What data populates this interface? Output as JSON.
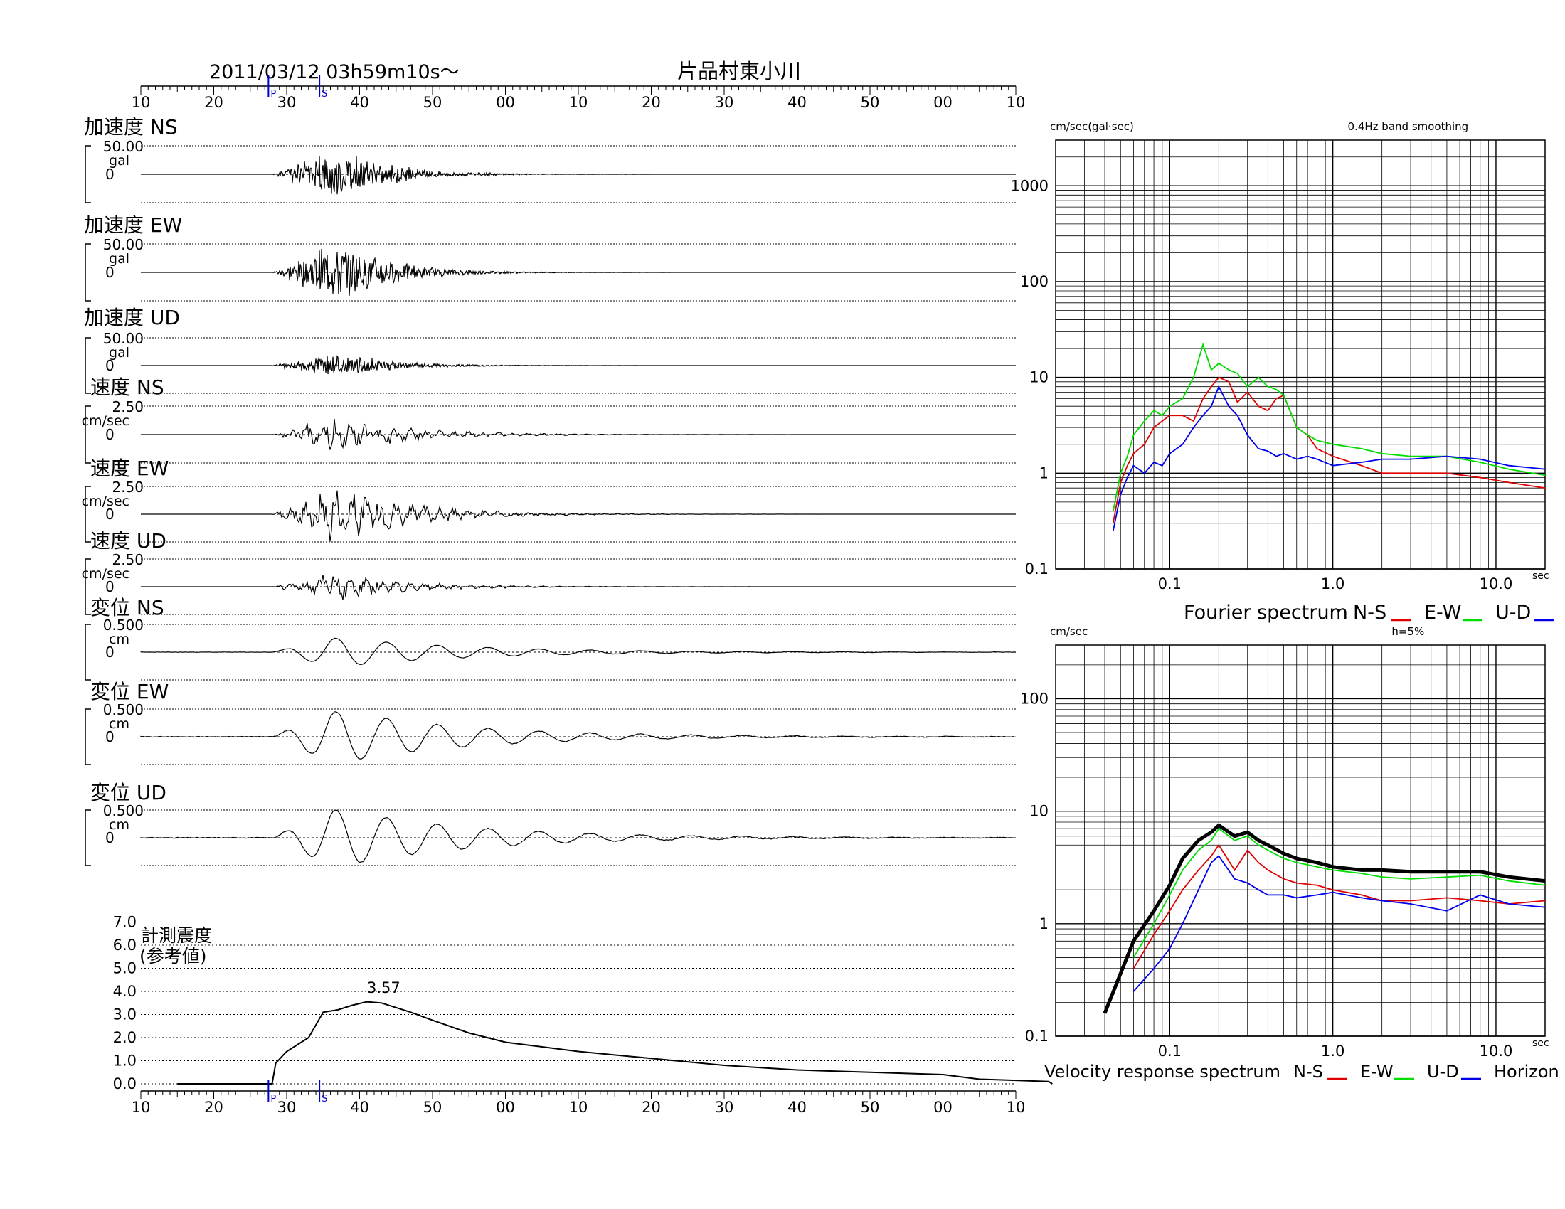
{
  "header": {
    "datetime": "2011/03/12  03h59m10s〜",
    "station": "片品村東小川"
  },
  "time_axis": {
    "tick_labels": [
      "10",
      "20",
      "30",
      "40",
      "50",
      "00",
      "10",
      "20",
      "30",
      "40",
      "50",
      "00",
      "10"
    ],
    "p_marker": "P",
    "s_marker": "S"
  },
  "traces": [
    {
      "title": "加速度 NS",
      "scale": "50.00",
      "unit": "gal",
      "zero": "0",
      "kind": "acc",
      "amp": 0.9,
      "seed": 3
    },
    {
      "title": "加速度 EW",
      "scale": "50.00",
      "unit": "gal",
      "zero": "0",
      "kind": "acc",
      "amp": 1.15,
      "seed": 7
    },
    {
      "title": "加速度 UD",
      "scale": "50.00",
      "unit": "gal",
      "zero": "0",
      "kind": "acc",
      "amp": 0.5,
      "seed": 11
    },
    {
      "title": "速度 NS",
      "scale": "2.50",
      "unit": "cm/sec",
      "zero": "0",
      "kind": "vel",
      "amp": 0.6,
      "seed": 13
    },
    {
      "title": "速度 EW",
      "scale": "2.50",
      "unit": "cm/sec",
      "zero": "0",
      "kind": "vel",
      "amp": 0.95,
      "seed": 17
    },
    {
      "title": "速度 UD",
      "scale": "2.50",
      "unit": "cm/sec",
      "zero": "0",
      "kind": "vel",
      "amp": 0.45,
      "seed": 19
    },
    {
      "title": "変位 NS",
      "scale": "0.500",
      "unit": "cm",
      "zero": "0",
      "kind": "disp",
      "amp": 0.5,
      "seed": 23
    },
    {
      "title": "変位 EW",
      "scale": "0.500",
      "unit": "cm",
      "zero": "0",
      "kind": "disp",
      "amp": 0.9,
      "seed": 29
    },
    {
      "title": "変位 UD",
      "scale": "0.500",
      "unit": "cm",
      "zero": "0",
      "kind": "disp",
      "amp": 1.0,
      "seed": 31
    }
  ],
  "intensity": {
    "title_line1": "計測震度",
    "title_line2": "(参考値)",
    "max_label": "3.57",
    "y_ticks": [
      "7.0",
      "6.0",
      "5.0",
      "4.0",
      "3.0",
      "2.0",
      "1.0",
      "0.0"
    ]
  },
  "colors": {
    "ns": "#e00000",
    "ew": "#00dd00",
    "ud": "#0000ee",
    "horizon": "#000000",
    "marker": "#0000cc"
  },
  "chart_data": [
    {
      "type": "line",
      "title": "Fourier spectrum",
      "ylabel": "cm/sec(gal·sec)",
      "xlabel": "sec",
      "note": "0.4Hz band smoothing",
      "x_scale": "log",
      "y_scale": "log",
      "xlim": [
        0.02,
        20
      ],
      "ylim": [
        0.1,
        3000
      ],
      "x_tick_labels": [
        "0.1",
        "1.0",
        "10.0"
      ],
      "y_tick_labels": [
        "0.1",
        "1",
        "10",
        "100",
        "1000"
      ],
      "legend": [
        "N-S",
        "E-W",
        "U-D"
      ],
      "series": [
        {
          "name": "N-S",
          "color": "#e00000",
          "x": [
            0.045,
            0.05,
            0.055,
            0.06,
            0.07,
            0.08,
            0.09,
            0.1,
            0.12,
            0.14,
            0.16,
            0.18,
            0.2,
            0.23,
            0.26,
            0.3,
            0.35,
            0.4,
            0.45,
            0.5,
            0.6,
            0.7,
            0.8,
            1.0,
            1.5,
            2,
            3,
            5,
            8,
            12,
            20
          ],
          "y": [
            0.3,
            0.8,
            1.2,
            1.6,
            2.0,
            3.0,
            3.5,
            4.0,
            4.0,
            3.5,
            6.0,
            8.0,
            10.0,
            9.0,
            5.5,
            7.0,
            5.0,
            4.5,
            6.0,
            6.5,
            3.0,
            2.5,
            1.8,
            1.5,
            1.2,
            1.0,
            1.0,
            1.0,
            0.9,
            0.8,
            0.7
          ]
        },
        {
          "name": "E-W",
          "color": "#00dd00",
          "x": [
            0.045,
            0.05,
            0.055,
            0.06,
            0.07,
            0.08,
            0.09,
            0.1,
            0.12,
            0.14,
            0.16,
            0.18,
            0.2,
            0.23,
            0.26,
            0.3,
            0.35,
            0.4,
            0.45,
            0.5,
            0.6,
            0.7,
            0.8,
            1.0,
            1.5,
            2,
            3,
            5,
            8,
            12,
            20
          ],
          "y": [
            0.4,
            1.0,
            1.5,
            2.5,
            3.5,
            4.5,
            4.0,
            5.0,
            6.0,
            10.0,
            22.0,
            12.0,
            14.0,
            12.0,
            11.0,
            8.0,
            10.0,
            8.0,
            7.5,
            6.5,
            3.0,
            2.5,
            2.2,
            2.0,
            1.8,
            1.6,
            1.5,
            1.5,
            1.3,
            1.1,
            0.95
          ]
        },
        {
          "name": "U-D",
          "color": "#0000ee",
          "x": [
            0.045,
            0.05,
            0.055,
            0.06,
            0.07,
            0.08,
            0.09,
            0.1,
            0.12,
            0.14,
            0.16,
            0.18,
            0.2,
            0.23,
            0.26,
            0.3,
            0.35,
            0.4,
            0.45,
            0.5,
            0.6,
            0.7,
            0.8,
            1.0,
            1.5,
            2,
            3,
            5,
            8,
            12,
            20
          ],
          "y": [
            0.25,
            0.6,
            0.9,
            1.2,
            1.0,
            1.3,
            1.2,
            1.6,
            2.0,
            3.0,
            4.0,
            5.0,
            8.0,
            5.0,
            4.0,
            2.5,
            1.8,
            1.7,
            1.5,
            1.6,
            1.4,
            1.5,
            1.4,
            1.2,
            1.3,
            1.4,
            1.4,
            1.5,
            1.4,
            1.2,
            1.1
          ]
        }
      ]
    },
    {
      "type": "line",
      "title": "Velocity response spectrum",
      "ylabel": "cm/sec",
      "xlabel": "sec",
      "note": "h=5%",
      "x_scale": "log",
      "y_scale": "log",
      "xlim": [
        0.02,
        20
      ],
      "ylim": [
        0.1,
        300
      ],
      "x_tick_labels": [
        "0.1",
        "1.0",
        "10.0"
      ],
      "y_tick_labels": [
        "0.1",
        "1",
        "10",
        "100"
      ],
      "legend": [
        "N-S",
        "E-W",
        "U-D",
        "Horizon"
      ],
      "series": [
        {
          "name": "N-S",
          "color": "#e00000",
          "x": [
            0.06,
            0.08,
            0.1,
            0.12,
            0.15,
            0.18,
            0.2,
            0.25,
            0.3,
            0.35,
            0.4,
            0.5,
            0.6,
            0.8,
            1.0,
            1.5,
            2,
            3,
            5,
            8,
            12,
            20
          ],
          "y": [
            0.4,
            0.8,
            1.3,
            2.0,
            3.0,
            4.0,
            5.0,
            3.0,
            4.5,
            3.5,
            3.0,
            2.5,
            2.3,
            2.2,
            2.0,
            1.8,
            1.6,
            1.6,
            1.7,
            1.6,
            1.5,
            1.6
          ]
        },
        {
          "name": "E-W",
          "color": "#00dd00",
          "x": [
            0.06,
            0.08,
            0.1,
            0.12,
            0.15,
            0.18,
            0.2,
            0.25,
            0.3,
            0.35,
            0.4,
            0.5,
            0.6,
            0.8,
            1.0,
            1.5,
            2,
            3,
            5,
            8,
            12,
            20
          ],
          "y": [
            0.5,
            1.0,
            1.8,
            3.0,
            4.5,
            5.5,
            7.0,
            5.5,
            6.0,
            5.0,
            4.5,
            3.8,
            3.5,
            3.2,
            3.0,
            2.8,
            2.6,
            2.5,
            2.6,
            2.7,
            2.4,
            2.2
          ]
        },
        {
          "name": "U-D",
          "color": "#0000ee",
          "x": [
            0.06,
            0.08,
            0.1,
            0.12,
            0.15,
            0.18,
            0.2,
            0.25,
            0.3,
            0.35,
            0.4,
            0.5,
            0.6,
            0.8,
            1.0,
            1.5,
            2,
            3,
            5,
            8,
            12,
            20
          ],
          "y": [
            0.25,
            0.4,
            0.6,
            1.0,
            2.0,
            3.5,
            4.0,
            2.5,
            2.3,
            2.0,
            1.8,
            1.8,
            1.7,
            1.8,
            1.9,
            1.7,
            1.6,
            1.5,
            1.3,
            1.8,
            1.5,
            1.4
          ]
        },
        {
          "name": "Horizon",
          "color": "#000000",
          "x": [
            0.04,
            0.06,
            0.08,
            0.1,
            0.12,
            0.15,
            0.18,
            0.2,
            0.25,
            0.3,
            0.35,
            0.4,
            0.5,
            0.6,
            0.8,
            1.0,
            1.5,
            2,
            3,
            5,
            8,
            12,
            20
          ],
          "y": [
            0.16,
            0.7,
            1.3,
            2.2,
            3.8,
            5.5,
            6.5,
            7.5,
            6.0,
            6.5,
            5.5,
            5.0,
            4.2,
            3.8,
            3.5,
            3.2,
            3.0,
            3.0,
            2.9,
            2.9,
            2.9,
            2.6,
            2.4
          ]
        }
      ]
    },
    {
      "type": "line",
      "title": "計測震度 (参考値)",
      "x_tick_labels": [
        "10",
        "20",
        "30",
        "40",
        "50",
        "00",
        "10",
        "20",
        "30",
        "40",
        "50",
        "00",
        "10"
      ],
      "ylim": [
        0,
        7
      ],
      "annotation": "3.57",
      "series": [
        {
          "name": "",
          "t": [
            15,
            28,
            28.5,
            30,
            33,
            35,
            37,
            39,
            41,
            43,
            45,
            47,
            50,
            55,
            60,
            70,
            80,
            90,
            100,
            110,
            120,
            125,
            130,
            134.5,
            135
          ],
          "y": [
            0,
            0,
            0.9,
            1.4,
            2.0,
            3.1,
            3.2,
            3.4,
            3.55,
            3.5,
            3.3,
            3.1,
            2.75,
            2.2,
            1.8,
            1.4,
            1.1,
            0.8,
            0.6,
            0.5,
            0.4,
            0.2,
            0.15,
            0.1,
            0
          ]
        }
      ]
    }
  ]
}
